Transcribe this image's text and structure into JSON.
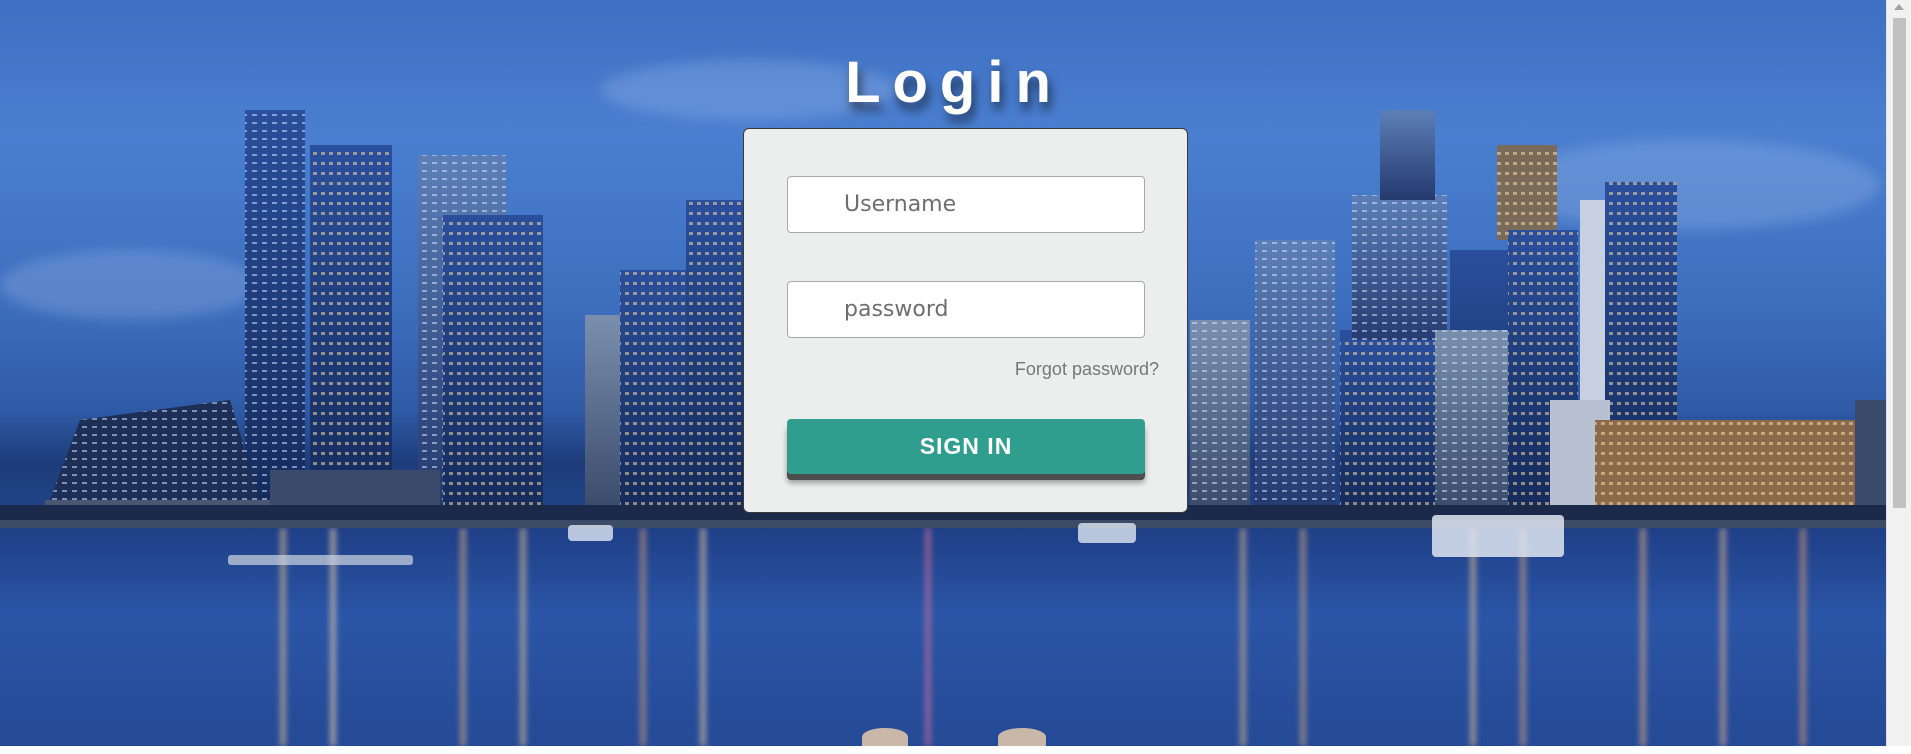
{
  "page": {
    "title": "Login"
  },
  "form": {
    "username_placeholder": "Username",
    "password_placeholder": "password",
    "forgot_label": "Forgot password?",
    "signin_label": "SIGN IN"
  },
  "colors": {
    "accent": "#2f9e8e",
    "card_bg": "#eceeee",
    "sky": "#4a7fd0"
  }
}
